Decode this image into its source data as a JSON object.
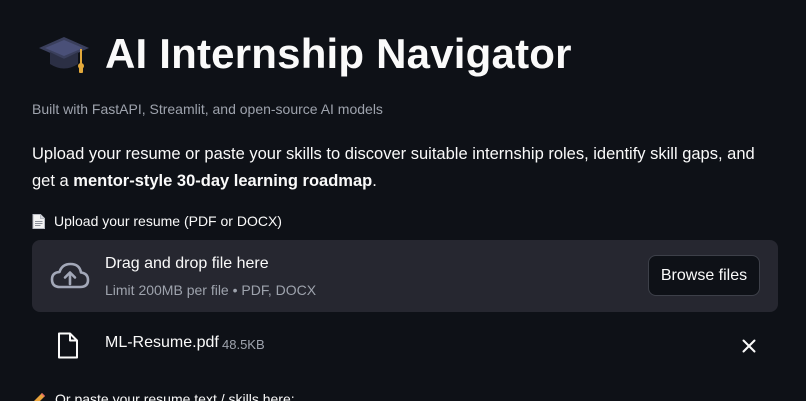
{
  "header": {
    "title": "AI Internship Navigator",
    "title_icon": "graduation-cap-icon",
    "subtitle": "Built with FastAPI, Streamlit, and open-source AI models"
  },
  "intro": {
    "text": "Upload your resume or paste your skills to discover suitable internship roles, identify skill gaps, and get a ",
    "bold": "mentor-style 30-day learning roadmap",
    "end": "."
  },
  "uploader": {
    "label_icon": "page-icon",
    "label": "Upload your resume (PDF or DOCX)",
    "dropzone_icon": "cloud-upload-icon",
    "drag_text": "Drag and drop file here",
    "limit_text": "Limit 200MB per file • PDF, DOCX",
    "browse_label": "Browse files"
  },
  "uploaded_file": {
    "icon": "file-icon",
    "name": "ML-Resume.pdf",
    "size": "48.5KB",
    "remove_icon": "close-icon"
  },
  "paste": {
    "label_icon": "pencil-icon",
    "label": "Or paste your resume text / skills here:"
  },
  "colors": {
    "background": "#0e1117",
    "surface": "#262730",
    "text": "#fafafa",
    "muted": "#9ea3ad"
  }
}
